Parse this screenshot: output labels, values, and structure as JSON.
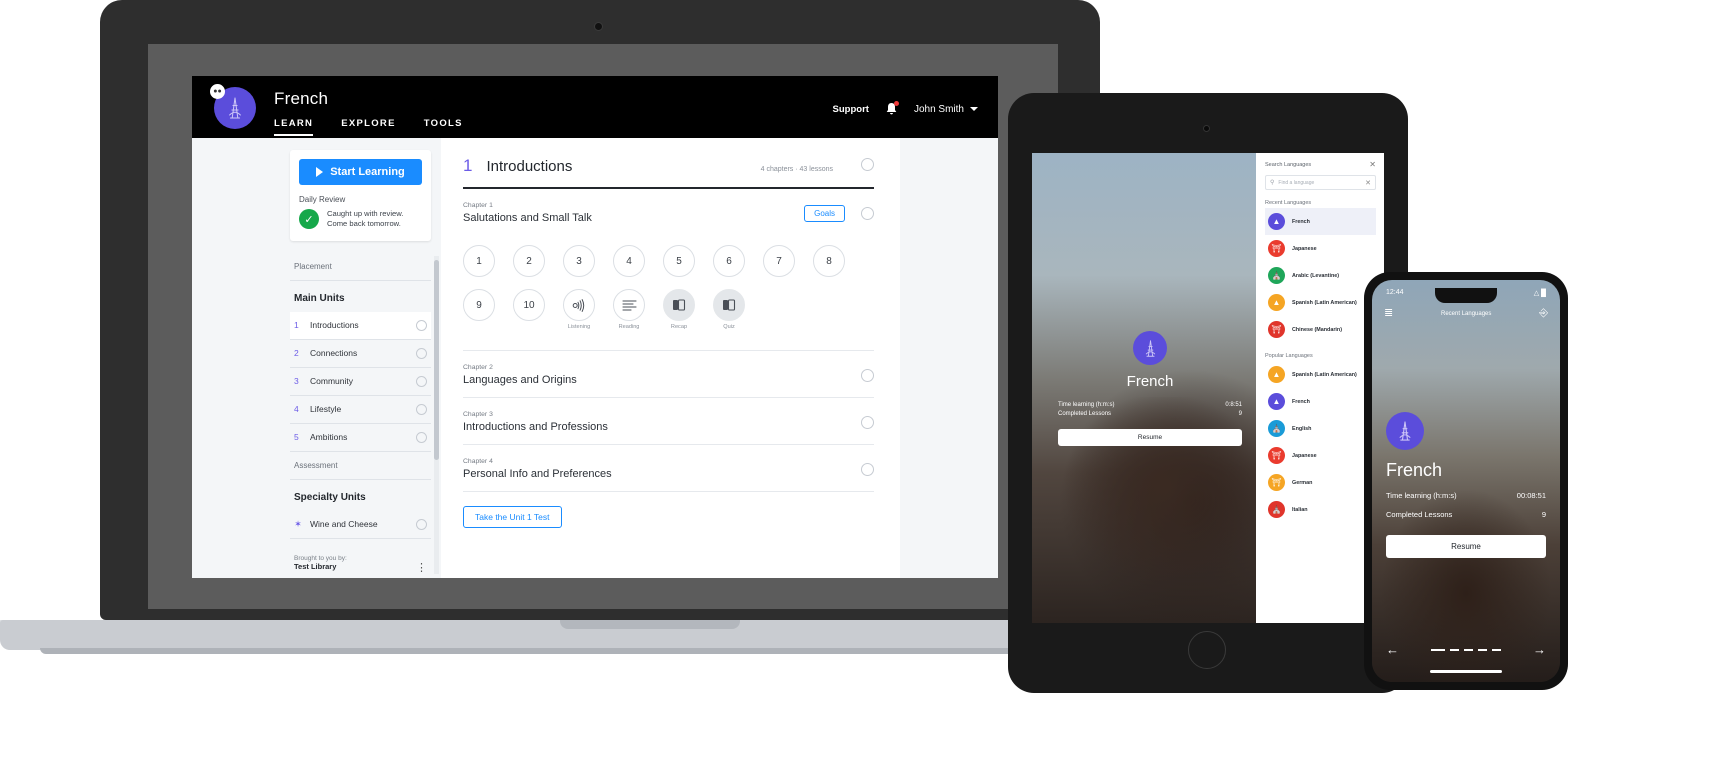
{
  "laptop": {
    "header": {
      "brand_badge_icon": "speech-bubble-icon",
      "logo_icon": "eiffel-tower-icon",
      "app_title": "French",
      "tabs": [
        {
          "label": "LEARN",
          "active": true
        },
        {
          "label": "EXPLORE",
          "active": false
        },
        {
          "label": "TOOLS",
          "active": false
        }
      ],
      "support_label": "Support",
      "bell_icon": "notification-bell-icon",
      "user_name": "John Smith",
      "caret_icon": "chevron-down-icon"
    },
    "sidebar": {
      "start_button": "Start Learning",
      "play_icon": "play-icon",
      "daily_review_label": "Daily Review",
      "check_icon": "check-circle-icon",
      "review_line1": "Caught up with review.",
      "review_line2": "Come back tomorrow.",
      "placement_label": "Placement",
      "main_units_label": "Main Units",
      "main_units": [
        {
          "num": "1",
          "label": "Introductions"
        },
        {
          "num": "2",
          "label": "Connections"
        },
        {
          "num": "3",
          "label": "Community"
        },
        {
          "num": "4",
          "label": "Lifestyle"
        },
        {
          "num": "5",
          "label": "Ambitions"
        }
      ],
      "assessment_label": "Assessment",
      "specialty_units_label": "Specialty Units",
      "specialty_units": [
        {
          "icon": "sparkle-icon",
          "label": "Wine and Cheese"
        }
      ],
      "footer_kicker": "Brought to you by:",
      "footer_name": "Test Library",
      "kebab_icon": "kebab-menu-icon"
    },
    "main": {
      "unit_number": "1",
      "unit_title": "Introductions",
      "unit_meta": "4 chapters · 43 lessons",
      "chapters": [
        {
          "kicker": "Chapter 1",
          "title": "Salutations and Small Talk",
          "goals_label": "Goals",
          "has_goals": true
        },
        {
          "kicker": "Chapter 2",
          "title": "Languages and Origins",
          "has_goals": false
        },
        {
          "kicker": "Chapter 3",
          "title": "Introductions and Professions",
          "has_goals": false
        },
        {
          "kicker": "Chapter 4",
          "title": "Personal Info and Preferences",
          "has_goals": false
        }
      ],
      "lessons_row1": [
        "1",
        "2",
        "3",
        "4",
        "5",
        "6",
        "7",
        "8"
      ],
      "lessons_row2": [
        {
          "label": "9",
          "caption": "",
          "icon": "",
          "filled": false
        },
        {
          "label": "10",
          "caption": "",
          "icon": "",
          "filled": false
        },
        {
          "label": "",
          "caption": "Listening",
          "icon": "speaker-icon",
          "filled": false
        },
        {
          "label": "",
          "caption": "Reading",
          "icon": "text-lines-icon",
          "filled": false
        },
        {
          "label": "",
          "caption": "Recap",
          "icon": "cards-icon",
          "filled": true
        },
        {
          "label": "",
          "caption": "Quiz",
          "icon": "cards-icon",
          "filled": true
        }
      ],
      "unit_test_button": "Take the Unit 1 Test"
    }
  },
  "tablet": {
    "hero": {
      "logo_icon": "eiffel-tower-icon",
      "language": "French",
      "time_label": "Time learning (h:m:s)",
      "time_value": "0:8:51",
      "lessons_label": "Completed Lessons",
      "lessons_value": "9",
      "resume_label": "Resume"
    },
    "panel": {
      "title": "Search Languages",
      "close_icon": "close-icon",
      "search_icon": "search-icon",
      "search_placeholder": "Find a language",
      "clear_icon": "clear-icon",
      "recent_label": "Recent Languages",
      "recent": [
        {
          "name": "French",
          "icon": "eiffel-tower-icon",
          "color": "#5b4ddb",
          "selected": true
        },
        {
          "name": "Japanese",
          "icon": "torii-gate-icon",
          "color": "#ea3b2e"
        },
        {
          "name": "Arabic (Levantine)",
          "icon": "mosque-icon",
          "color": "#1fa65a"
        },
        {
          "name": "Spanish (Latin American)",
          "icon": "pyramid-icon",
          "color": "#f5a524"
        },
        {
          "name": "Chinese (Mandarin)",
          "icon": "pagoda-icon",
          "color": "#e0352b"
        }
      ],
      "popular_label": "Popular Languages",
      "popular": [
        {
          "name": "Spanish (Latin American)",
          "icon": "pyramid-icon",
          "color": "#f5a524"
        },
        {
          "name": "French",
          "icon": "eiffel-tower-icon",
          "color": "#5b4ddb"
        },
        {
          "name": "English",
          "icon": "bridge-icon",
          "color": "#1a9bd7"
        },
        {
          "name": "Japanese",
          "icon": "torii-gate-icon",
          "color": "#ea3b2e"
        },
        {
          "name": "German",
          "icon": "gate-icon",
          "color": "#f5a524"
        },
        {
          "name": "Italian",
          "icon": "colosseum-icon",
          "color": "#e0352b"
        }
      ]
    }
  },
  "phone": {
    "status_time": "12:44",
    "status_icons": "wifi-battery-icon",
    "nav_title": "Recent Languages",
    "list_icon": "list-icon",
    "profile_icon": "person-icon",
    "logo_icon": "eiffel-tower-icon",
    "language": "French",
    "time_label": "Time learning (h:m:s)",
    "time_value": "00:08:51",
    "lessons_label": "Completed Lessons",
    "lessons_value": "9",
    "resume_label": "Resume",
    "back_icon": "arrow-left-icon",
    "forward_icon": "arrow-right-icon"
  }
}
